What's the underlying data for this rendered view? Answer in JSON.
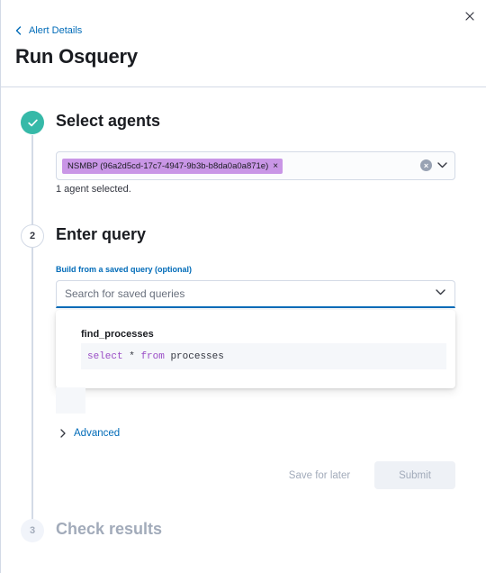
{
  "header": {
    "back_link_label": "Alert Details",
    "title": "Run Osquery"
  },
  "steps": {
    "select_agents": {
      "title": "Select agents",
      "selected_agent": "NSMBP (96a2d5cd-17c7-4947-9b3b-b8da0a0a871e)",
      "selected_count_text": "1 agent selected."
    },
    "enter_query": {
      "number": "2",
      "title": "Enter query",
      "saved_query_label": "Build from a saved query (optional)",
      "saved_query_placeholder": "Search for saved queries",
      "options": [
        {
          "name": "find_processes",
          "query": "select * from processes"
        }
      ],
      "advanced_label": "Advanced",
      "save_for_later_label": "Save for later",
      "submit_label": "Submit"
    },
    "check_results": {
      "number": "3",
      "title": "Check results"
    }
  },
  "icons": {
    "close": "close-icon",
    "back": "chevron-left-icon",
    "step_complete": "check-icon",
    "clear": "clear-icon",
    "dropdown": "chevron-down-icon",
    "advanced": "chevron-right-icon"
  },
  "colors": {
    "accent": "#006bb8",
    "step_complete": "#36b9a8",
    "agent_pill": "#c996e6",
    "keyword": "#9a4ec6",
    "disabled_text": "#a2abba"
  }
}
